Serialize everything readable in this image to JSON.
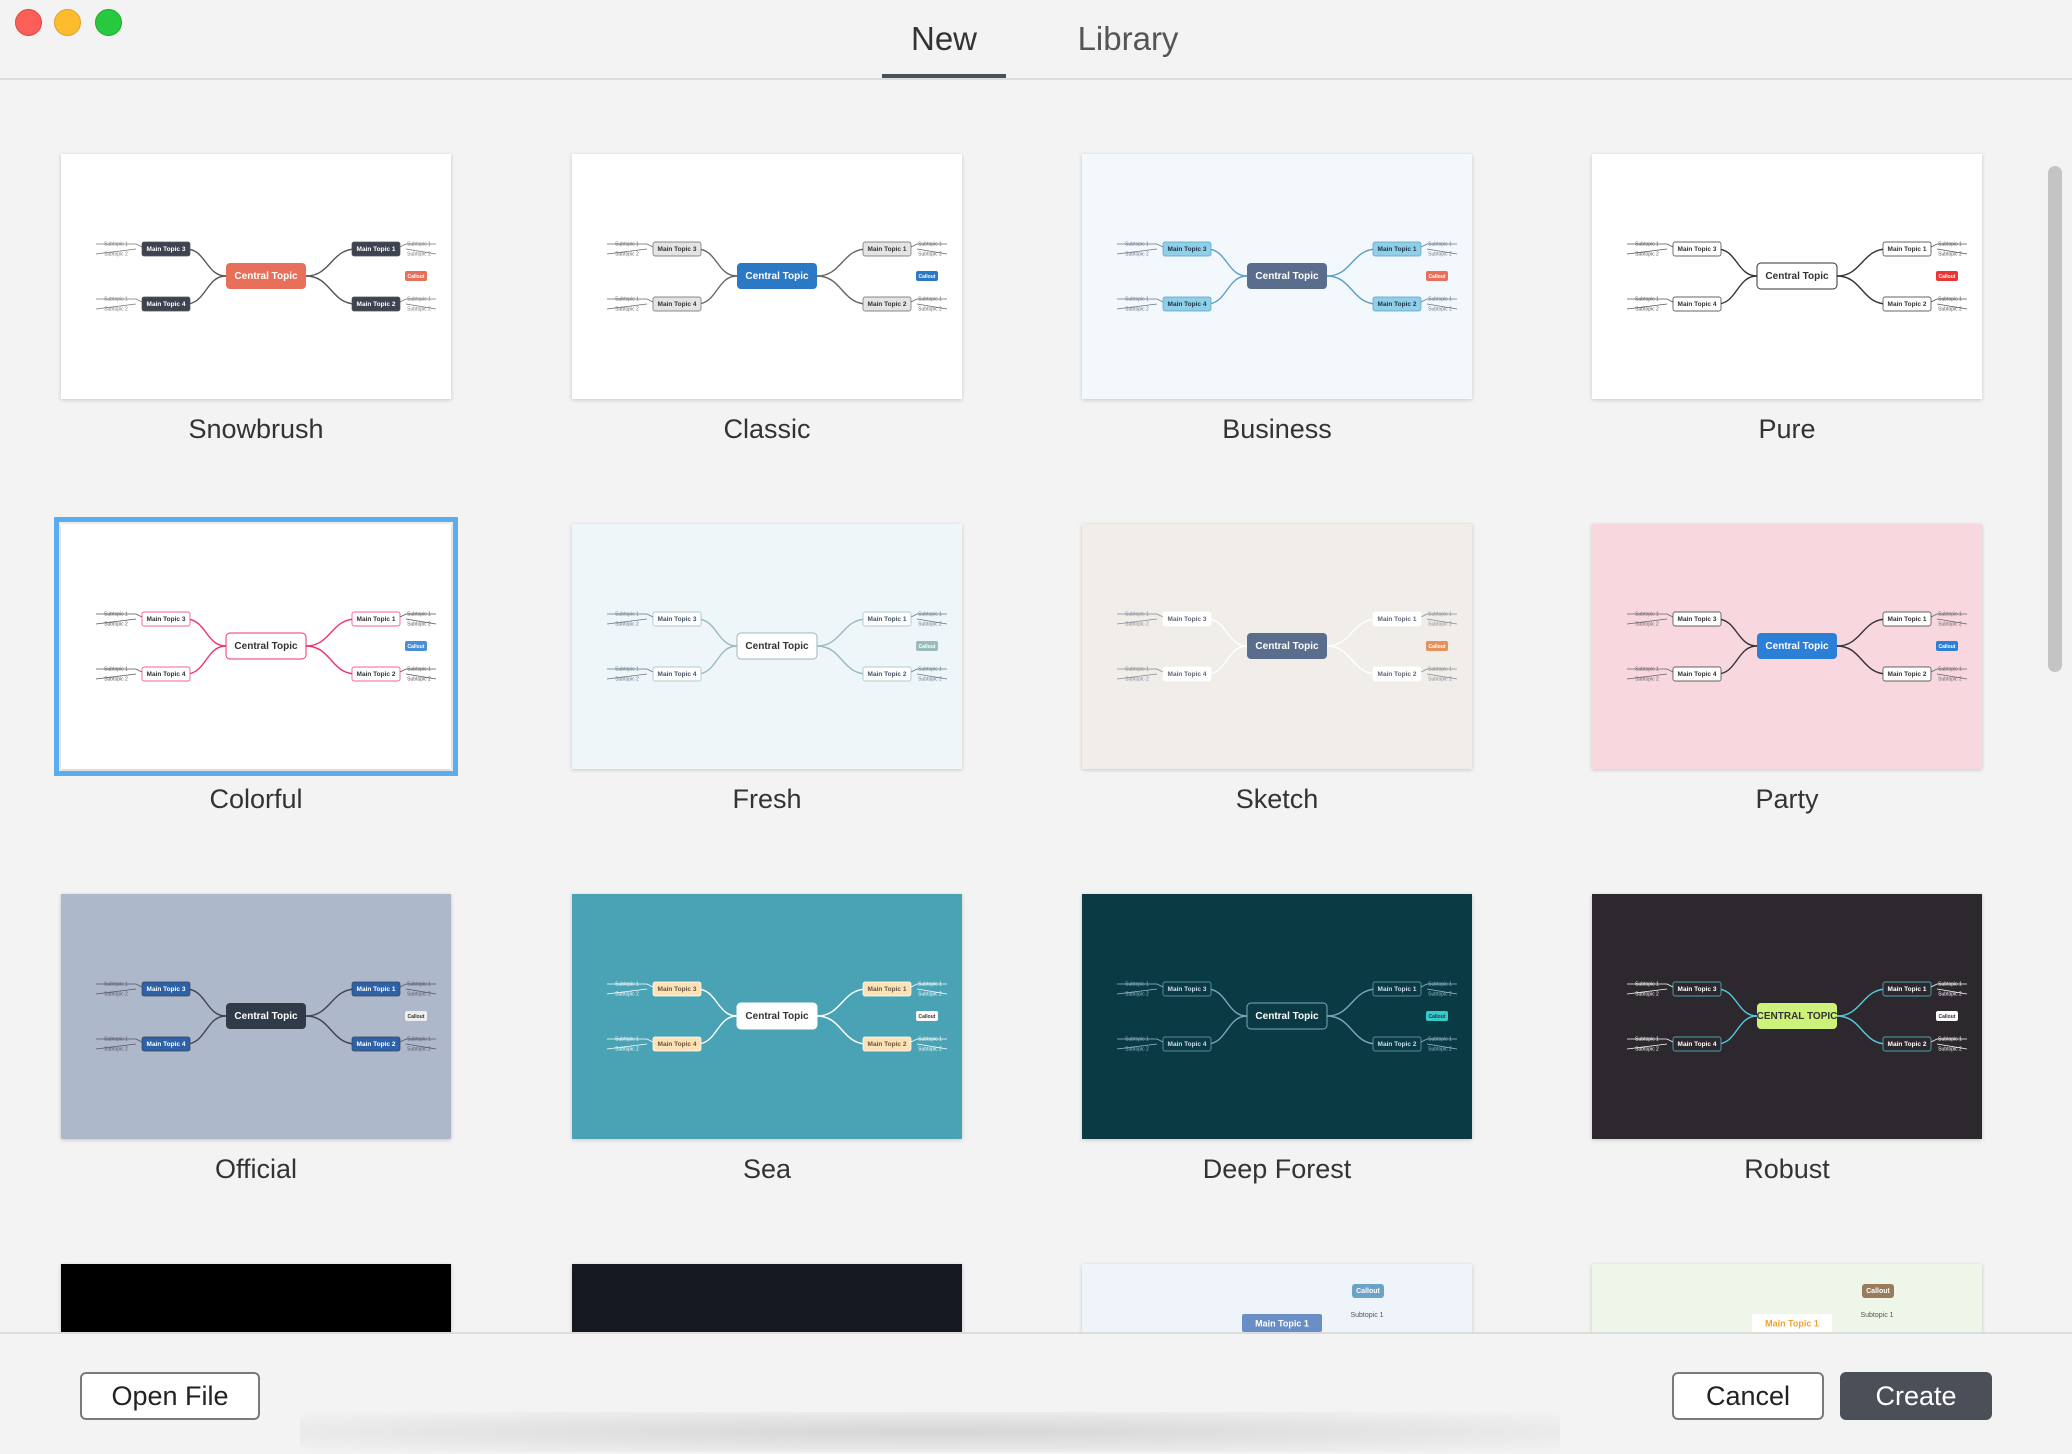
{
  "window": {
    "tabs": [
      {
        "label": "New",
        "active": true
      },
      {
        "label": "Library",
        "active": false
      }
    ]
  },
  "templates": [
    {
      "name": "Snowbrush",
      "bg": "#ffffff",
      "central": "Central Topic",
      "central_fill": "#e8705a"
    },
    {
      "name": "Classic",
      "bg": "#ffffff",
      "central": "Central Topic",
      "central_fill": "#2b78c5"
    },
    {
      "name": "Business",
      "bg": "#f3f8fd",
      "central": "Central Topic",
      "central_fill": "#5a6d8c"
    },
    {
      "name": "Pure",
      "bg": "#ffffff",
      "central": "Central Topic",
      "central_fill": "#ffffff"
    },
    {
      "name": "Colorful",
      "bg": "#ffffff",
      "central": "Central Topic",
      "central_fill": "#ffffff",
      "selected": true
    },
    {
      "name": "Fresh",
      "bg": "#eef6f9",
      "central": "Central Topic",
      "central_fill": "#ffffff"
    },
    {
      "name": "Sketch",
      "bg": "#f1ede8",
      "central": "Central Topic",
      "central_fill": "#5a6d8c"
    },
    {
      "name": "Party",
      "bg": "#f8d7df",
      "central": "Central Topic",
      "central_fill": "#2b7fd6"
    },
    {
      "name": "Official",
      "bg": "#aeb8cb",
      "central": "Central Topic",
      "central_fill": "#303a48"
    },
    {
      "name": "Sea",
      "bg": "#4aa3b5",
      "central": "Central Topic",
      "central_fill": "#ffffff"
    },
    {
      "name": "Deep Forest",
      "bg": "#0a3a44",
      "central": "Central Topic",
      "central_fill": "#0a3a44"
    },
    {
      "name": "Robust",
      "bg": "#2d282e",
      "central": "CENTRAL TOPIC",
      "central_fill": "#cdf27a"
    }
  ],
  "node_labels": {
    "main1": "Main Topic 1",
    "main2": "Main Topic 2",
    "main3": "Main Topic 3",
    "main4": "Main Topic 4",
    "sub1": "Subtopic 1",
    "sub2": "Subtopic 2",
    "callout": "Callout"
  },
  "partial_row": [
    {
      "bg": "#000000"
    },
    {
      "bg": "#161821"
    },
    {
      "bg": "#eef4fa",
      "main": "Main Topic 1",
      "sub": "Subtopic 1",
      "callout": "Callout"
    },
    {
      "bg": "#eef6ea",
      "main": "Main Topic 1",
      "sub": "Subtopic 1",
      "callout": "Callout"
    }
  ],
  "footer": {
    "open_file": "Open File",
    "cancel": "Cancel",
    "create": "Create"
  }
}
